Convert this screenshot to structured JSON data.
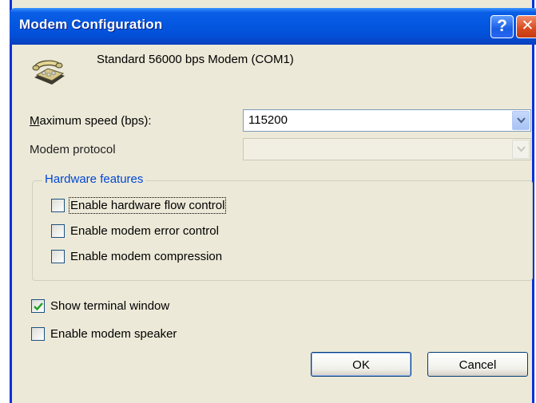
{
  "window": {
    "title": "Modem Configuration",
    "help_glyph": "?",
    "close_glyph": "✕"
  },
  "modem": {
    "icon": "telephone-modem-icon",
    "name": "Standard 56000 bps Modem (COM1)"
  },
  "max_speed": {
    "label": "Maximum speed (bps):",
    "value": "115200"
  },
  "protocol": {
    "label": "Modem protocol",
    "value": ""
  },
  "hardware": {
    "title": "Hardware features",
    "options": [
      {
        "label": "Enable hardware flow control",
        "checked": false
      },
      {
        "label": "Enable modem error control",
        "checked": false
      },
      {
        "label": "Enable modem compression",
        "checked": false
      }
    ]
  },
  "show_terminal": {
    "label": "Show terminal window",
    "checked": true
  },
  "speaker": {
    "label": "Enable modem speaker",
    "checked": false
  },
  "buttons": {
    "ok": "OK",
    "cancel": "Cancel"
  },
  "colors": {
    "title_bar": "#0458e1",
    "dialog_bg": "#ece9d8",
    "group_title": "#0046d5",
    "close_button": "#d94a1e"
  }
}
